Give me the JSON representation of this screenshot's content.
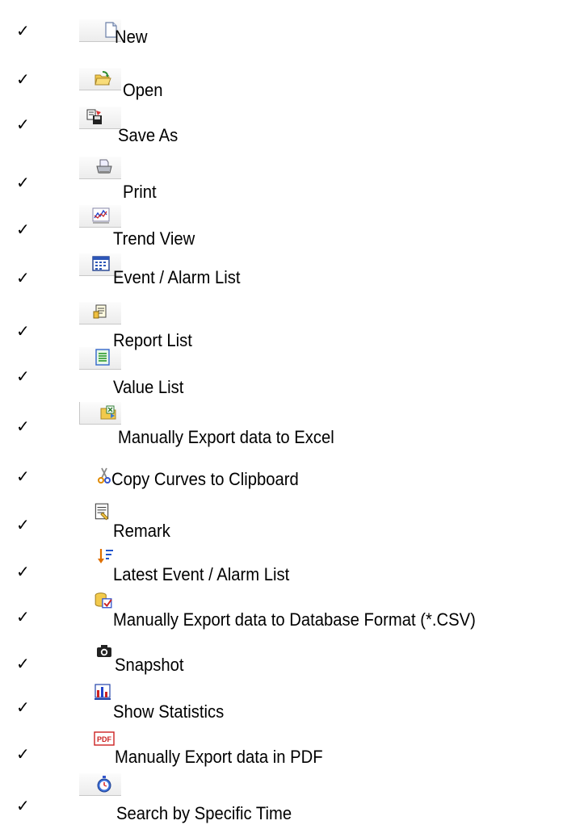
{
  "checkmark": "✓",
  "items": [
    {
      "label": "New",
      "icon": "new-document-icon"
    },
    {
      "label": "Open",
      "icon": "open-folder-icon"
    },
    {
      "label": "Save As",
      "icon": "save-as-icon"
    },
    {
      "label": "Print",
      "icon": "printer-icon"
    },
    {
      "label": "Trend View",
      "icon": "trend-chart-icon"
    },
    {
      "label": "Event / Alarm List",
      "icon": "event-list-icon"
    },
    {
      "label": "Report List",
      "icon": "report-list-icon"
    },
    {
      "label": "Value List",
      "icon": "value-list-icon"
    },
    {
      "label": "Manually Export data to Excel",
      "icon": "export-excel-icon"
    },
    {
      "label": "Copy Curves to Clipboard",
      "icon": "scissors-icon"
    },
    {
      "label": "Remark",
      "icon": "remark-icon"
    },
    {
      "label": "Latest Event / Alarm List",
      "icon": "sort-down-icon"
    },
    {
      "label": "Manually Export data to Database Format (*.CSV)",
      "icon": "database-export-icon"
    },
    {
      "label": "Snapshot",
      "icon": "camera-icon"
    },
    {
      "label": "Show Statistics",
      "icon": "statistics-icon"
    },
    {
      "label": "Manually Export data in PDF",
      "icon": "pdf-icon"
    },
    {
      "label": "Search by Specific Time",
      "icon": "stopwatch-icon"
    }
  ]
}
